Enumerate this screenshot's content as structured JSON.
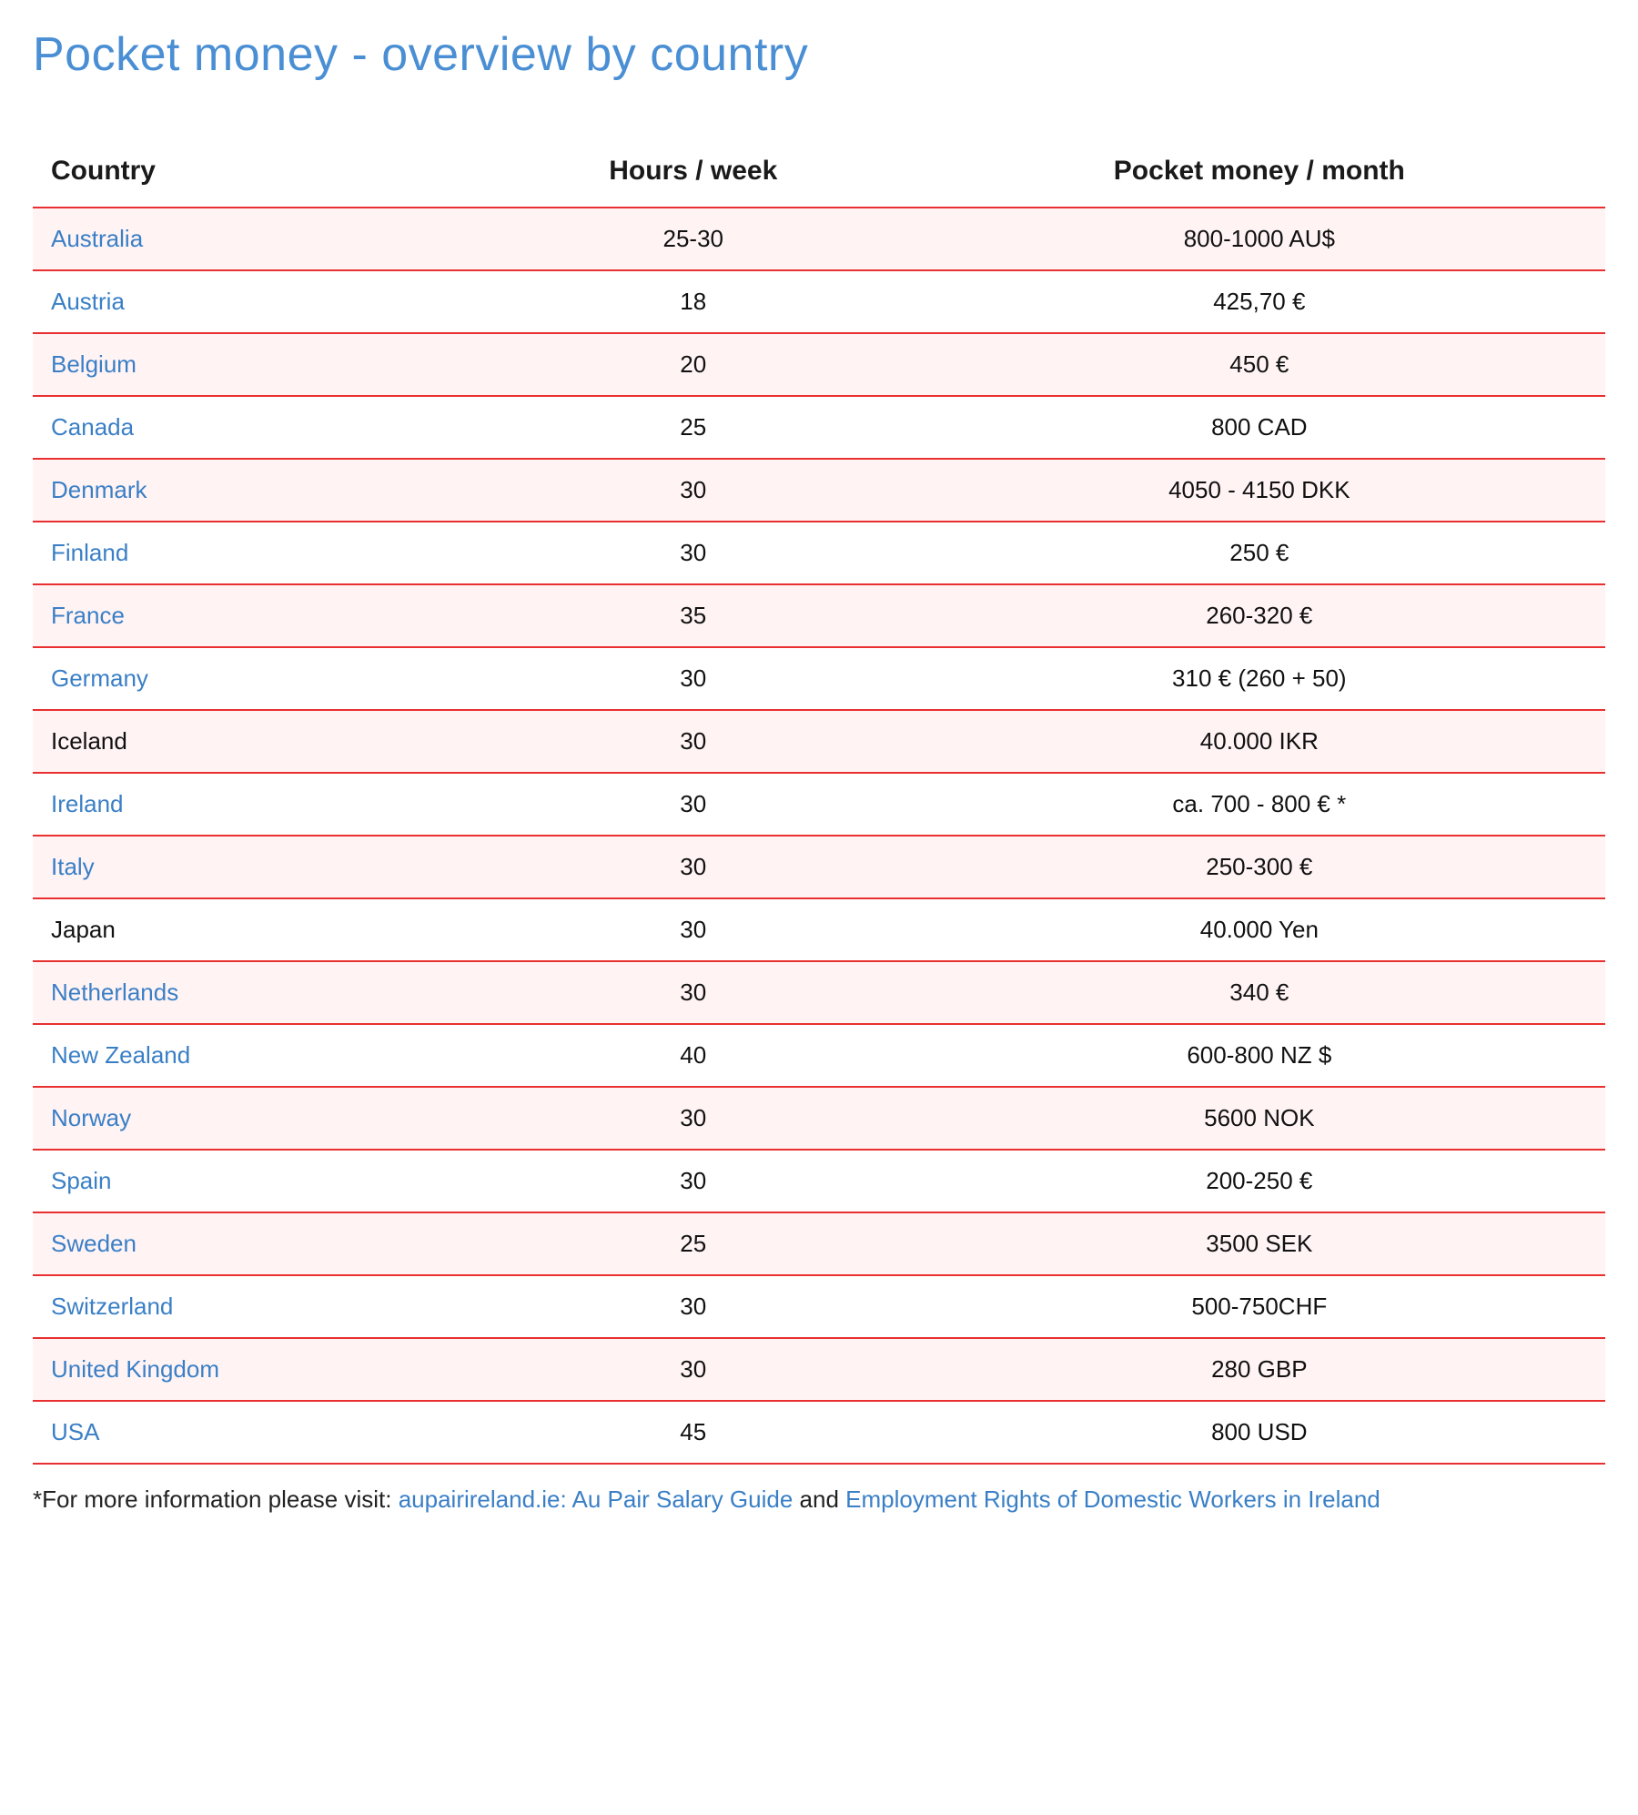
{
  "title": "Pocket money - overview by country",
  "table": {
    "headers": {
      "country": "Country",
      "hours": "Hours / week",
      "money": "Pocket money / month"
    },
    "rows": [
      {
        "country": "Australia",
        "link": true,
        "hours": "25-30",
        "money": "800-1000 AU$"
      },
      {
        "country": "Austria",
        "link": true,
        "hours": "18",
        "money": "425,70 €"
      },
      {
        "country": "Belgium",
        "link": true,
        "hours": "20",
        "money": "450 €"
      },
      {
        "country": "Canada",
        "link": true,
        "hours": "25",
        "money": "800 CAD"
      },
      {
        "country": "Denmark",
        "link": true,
        "hours": "30",
        "money": "4050 - 4150 DKK"
      },
      {
        "country": "Finland",
        "link": true,
        "hours": "30",
        "money": "250 €"
      },
      {
        "country": "France",
        "link": true,
        "hours": "35",
        "money": "260-320 €"
      },
      {
        "country": "Germany",
        "link": true,
        "hours": "30",
        "money": "310 € (260 + 50)"
      },
      {
        "country": "Iceland",
        "link": false,
        "hours": "30",
        "money": "40.000 IKR"
      },
      {
        "country": "Ireland",
        "link": true,
        "hours": "30",
        "money": "ca. 700 - 800 € *"
      },
      {
        "country": "Italy",
        "link": true,
        "hours": "30",
        "money": "250-300 €"
      },
      {
        "country": "Japan",
        "link": false,
        "hours": "30",
        "money": "40.000 Yen"
      },
      {
        "country": "Netherlands",
        "link": true,
        "hours": "30",
        "money": "340 €"
      },
      {
        "country": "New Zealand",
        "link": true,
        "hours": "40",
        "money": "600-800 NZ $"
      },
      {
        "country": "Norway",
        "link": true,
        "hours": "30",
        "money": "5600 NOK"
      },
      {
        "country": "Spain",
        "link": true,
        "hours": "30",
        "money": "200-250 €"
      },
      {
        "country": "Sweden",
        "link": true,
        "hours": "25",
        "money": "3500 SEK"
      },
      {
        "country": "Switzerland",
        "link": true,
        "hours": "30",
        "money": "500-750CHF"
      },
      {
        "country": "United Kingdom",
        "link": true,
        "hours": "30",
        "money": "280 GBP"
      },
      {
        "country": "USA",
        "link": true,
        "hours": "45",
        "money": "800 USD"
      }
    ]
  },
  "footnote": {
    "prefix": "*For more information please visit: ",
    "link1": "aupairireland.ie: Au Pair Salary Guide",
    "and": " and ",
    "link2": "Employment Rights of Domestic Workers in Ireland"
  }
}
